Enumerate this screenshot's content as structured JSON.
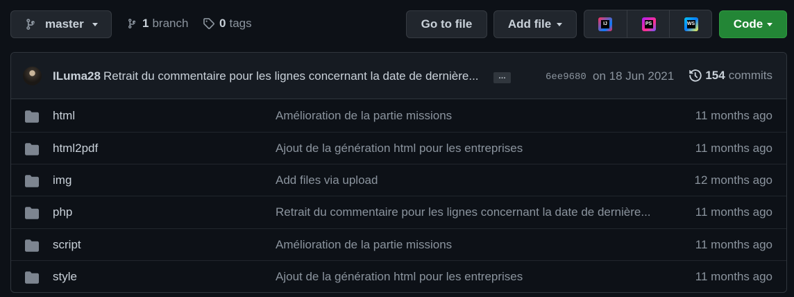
{
  "branch": {
    "name": "master",
    "branch_count": "1",
    "branch_label": "branch",
    "tag_count": "0",
    "tag_label": "tags"
  },
  "toolbar": {
    "go_to_file": "Go to file",
    "add_file": "Add file",
    "code": "Code"
  },
  "ide_icons": [
    {
      "name": "intellij-icon",
      "text": "IJ"
    },
    {
      "name": "phpstorm-icon",
      "text": "PS"
    },
    {
      "name": "webstorm-icon",
      "text": "WS"
    }
  ],
  "commit": {
    "author": "ILuma28",
    "message": "Retrait du commentaire pour les lignes concernant la date de dernière...",
    "ellipsis": "…",
    "sha": "6ee9680",
    "date": "on 18 Jun 2021",
    "commit_count": "154",
    "commit_label": "commits"
  },
  "files": [
    {
      "name": "html",
      "message": "Amélioration de la partie missions",
      "age": "11 months ago"
    },
    {
      "name": "html2pdf",
      "message": "Ajout de la génération html pour les entreprises",
      "age": "11 months ago"
    },
    {
      "name": "img",
      "message": "Add files via upload",
      "age": "12 months ago"
    },
    {
      "name": "php",
      "message": "Retrait du commentaire pour les lignes concernant la date de dernière...",
      "age": "11 months ago"
    },
    {
      "name": "script",
      "message": "Amélioration de la partie missions",
      "age": "11 months ago"
    },
    {
      "name": "style",
      "message": "Ajout de la génération html pour les entreprises",
      "age": "11 months ago"
    }
  ],
  "colors": {
    "background": "#0d1117",
    "code_button": "#238636",
    "folder_icon": "#7d8590"
  }
}
